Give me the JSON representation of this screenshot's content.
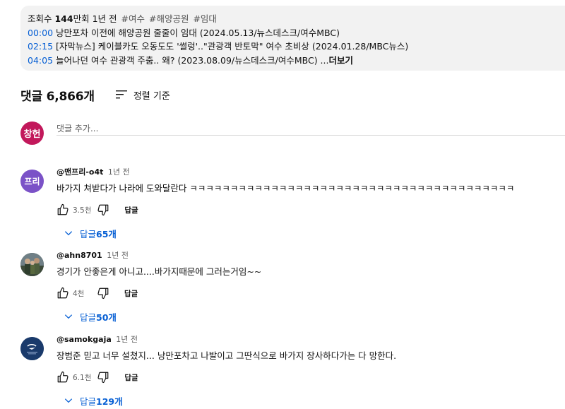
{
  "description": {
    "meta": {
      "views_prefix": "조회수 ",
      "views_value": "144",
      "views_suffix": "만회",
      "age": "1년 전",
      "tags": [
        "#여수",
        "#해양공원",
        "#임대"
      ]
    },
    "chapters": [
      {
        "time": "00:00",
        "text": "낭만포차 이전에 해양공원 줄줄이 임대 (2024.05.13/뉴스데스크/여수MBC)"
      },
      {
        "time": "02:15",
        "text": "[자막뉴스] 케이블카도 오동도도 '썰렁'..\"관광객 반토막\" 여수 초비상 (2024.01.28/MBC뉴스)"
      },
      {
        "time": "04:05",
        "text": "늘어나던 여수 관광객 주춤.. 왜? (2023.08.09/뉴스데스크/여수MBC) ..."
      }
    ],
    "more_label": "더보기"
  },
  "comments_header": {
    "count_label": "댓글 6,866개",
    "sort_label": "정렬 기준"
  },
  "add_comment": {
    "avatar_text": "창헌",
    "placeholder": "댓글 추가..."
  },
  "comments": [
    {
      "avatar_text": "프리",
      "avatar_color": "#7b52c7",
      "author": "@맨프리-o4t",
      "time": "1년 전",
      "text": "바가지 쳐받다가 나라에 도와달란다 ㅋㅋㅋㅋㅋㅋㅋㅋㅋㅋㅋㅋㅋㅋㅋㅋㅋㅋㅋㅋㅋㅋㅋㅋㅋㅋㅋㅋㅋㅋㅋㅋㅋㅋㅋㅋㅋㅋㅋㅋ",
      "likes": "3.5천",
      "reply_label": "답글",
      "replies_prefix": "답글 ",
      "replies_count": "65개"
    },
    {
      "avatar_text": "",
      "avatar_color": "#4a5a48",
      "author": "@ahn8701",
      "time": "1년 전",
      "text": "경기가 안좋은게 아니고....바가지때문에 그러는거임~~",
      "likes": "4천",
      "reply_label": "답글",
      "replies_prefix": "답글 ",
      "replies_count": "50개"
    },
    {
      "avatar_text": "",
      "avatar_color": "#1a3a6b",
      "author": "@samokgaja",
      "time": "1년 전",
      "text": "장범준 믿고 너무 설쳤지... 낭만포차고 나발이고 그딴식으로 바가지 장사하다가는 다 망한다.",
      "likes": "6.1천",
      "reply_label": "답글",
      "replies_prefix": "답글 ",
      "replies_count": "129개"
    }
  ],
  "colors": {
    "link_blue": "#065fd4",
    "text_primary": "#0f0f0f",
    "text_secondary": "#606060",
    "desc_bg": "#f2f2f2"
  },
  "icons": {
    "sort": "sort-icon",
    "like": "thumb-up-icon",
    "dislike": "thumb-down-icon",
    "expand": "chevron-down-icon"
  }
}
